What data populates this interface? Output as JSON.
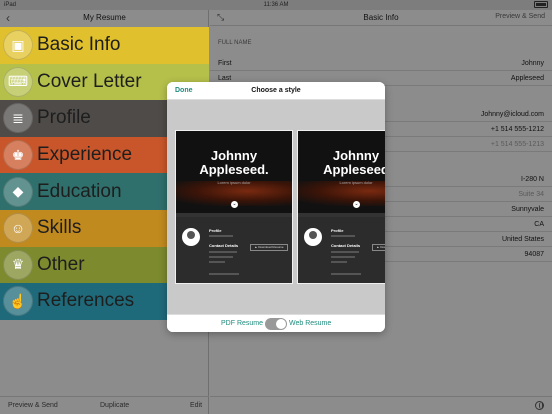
{
  "status": {
    "device": "iPad",
    "time": "11:36 AM"
  },
  "left": {
    "title": "My Resume",
    "items": [
      {
        "label": "Basic Info",
        "color": "#e0c12d",
        "icon": "id-badge-icon",
        "glyph": "▣"
      },
      {
        "label": "Cover Letter",
        "color": "#b5c04a",
        "icon": "typewriter-icon",
        "glyph": "⌨"
      },
      {
        "label": "Profile",
        "color": "#4e4b48",
        "icon": "document-icon",
        "glyph": "≣"
      },
      {
        "label": "Experience",
        "color": "#c8562a",
        "icon": "suit-icon",
        "glyph": "♚"
      },
      {
        "label": "Education",
        "color": "#2f6f6c",
        "icon": "graduation-cap-icon",
        "glyph": "◆"
      },
      {
        "label": "Skills",
        "color": "#c08a1f",
        "icon": "person-icon",
        "glyph": "☺"
      },
      {
        "label": "Other",
        "color": "#7d8a2e",
        "icon": "trophy-icon",
        "glyph": "♛"
      },
      {
        "label": "References",
        "color": "#1f6a7a",
        "icon": "thumbs-up-icon",
        "glyph": "☝"
      }
    ],
    "bottom": {
      "preview": "Preview & Send",
      "duplicate": "Duplicate",
      "edit": "Edit"
    }
  },
  "right": {
    "title": "Basic Info",
    "action": "Preview & Send",
    "section_full_name": "FULL NAME",
    "rows": [
      {
        "k": "First",
        "v": "Johnny",
        "faint": false
      },
      {
        "k": "Last",
        "v": "Appleseed",
        "faint": false
      },
      {
        "k": "",
        "v": "Johnny@icloud.com",
        "faint": false
      },
      {
        "k": "",
        "v": "+1 514 555-1212",
        "faint": false
      },
      {
        "k": "",
        "v": "+1 514 555-1213",
        "faint": true
      },
      {
        "k": "",
        "v": "I-280 N",
        "faint": false
      },
      {
        "k": "",
        "v": "Suite 34",
        "faint": true
      },
      {
        "k": "",
        "v": "Sunnyvale",
        "faint": false
      },
      {
        "k": "",
        "v": "CA",
        "faint": false
      },
      {
        "k": "",
        "v": "United States",
        "faint": false
      },
      {
        "k": "",
        "v": "94087",
        "faint": false
      }
    ]
  },
  "modal": {
    "done": "Done",
    "title": "Choose a style",
    "pdf_label": "PDF Resume",
    "web_label": "Web Resume",
    "toggle_on": true,
    "cards": [
      {
        "name": "Johnny\nAppleseed.",
        "tag": "Lorem ipsum dolor",
        "profile": "Profile",
        "contact": "Contact Details",
        "download": "▲ Download Resume"
      },
      {
        "name": "Johnny\nAppleseed",
        "tag": "Lorem ipsum dolor",
        "profile": "Profile",
        "contact": "Contact Details",
        "download": "▲ Download Resume"
      }
    ]
  }
}
